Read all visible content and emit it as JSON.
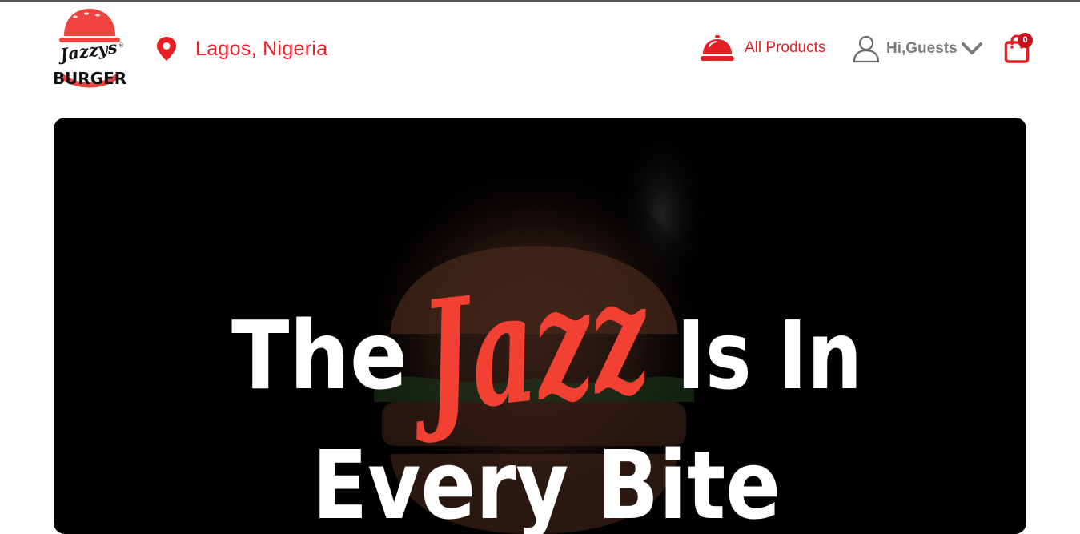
{
  "brand": {
    "script_name": "Jazzys",
    "word": "BURGER",
    "mark": "®",
    "colors": {
      "accent": "#e61e24",
      "dark": "#111111"
    }
  },
  "header": {
    "location": {
      "icon": "map-pin-icon",
      "label": "Lagos, Nigeria"
    },
    "nav": {
      "products": {
        "icon": "service-bell-icon",
        "label": "All Products"
      },
      "account": {
        "icon": "user-icon",
        "label": "Hi,Guests",
        "dropdown_icon": "chevron-down-icon"
      },
      "cart": {
        "icon": "shopping-bag-icon",
        "count": "0"
      }
    }
  },
  "hero": {
    "headline_before": "The",
    "headline_script": "Jazz",
    "headline_after": "Is In",
    "headline_line2": "Every Bite",
    "background": "#000000"
  }
}
